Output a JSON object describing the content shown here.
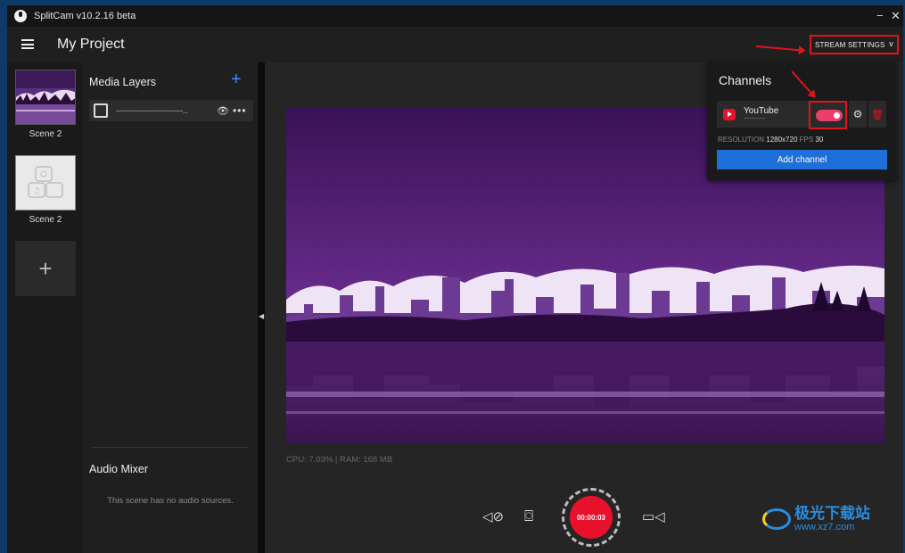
{
  "window": {
    "title": "SplitCam v10.2.16 beta",
    "minimize": "−",
    "close": "✕"
  },
  "header": {
    "project_title": "My Project",
    "stream_settings_label": "STREAM SETTINGS",
    "stream_settings_chevron": "v"
  },
  "scenes": [
    {
      "label": "Scene 2"
    },
    {
      "label": "Scene 2"
    }
  ],
  "scene_add_label": "+",
  "media_layers": {
    "title": "Media Layers",
    "add_label": "+",
    "layer_name": "------------------------------...",
    "eye_glyph": "👁",
    "more_glyph": "•••"
  },
  "audio_mixer": {
    "title": "Audio Mixer",
    "empty_text": "This scene has no audio sources."
  },
  "stats": "CPU: 7.03% | RAM: 168 MB",
  "controls": {
    "mute_glyph": "◁⊘",
    "snapshot_glyph": "⌼",
    "record_time": "00:00:03",
    "camera_glyph": "▭◁"
  },
  "channels": {
    "title": "Channels",
    "items": [
      {
        "name": "YouTube",
        "enabled": true
      }
    ],
    "resolution_label": "RESOLUTION",
    "resolution_value": "1280x720",
    "fps_label": "FPS",
    "fps_value": "30",
    "add_label": "Add channel",
    "gear_glyph": "⚙",
    "trash_glyph": "🗑"
  },
  "watermark": {
    "brand": "极光下载站",
    "url": "www.xz7.com"
  },
  "colors": {
    "accent_blue": "#1e6fd9",
    "record_red": "#e8102a",
    "highlight_red": "#e0141e",
    "toggle_on": "#e8406a"
  }
}
